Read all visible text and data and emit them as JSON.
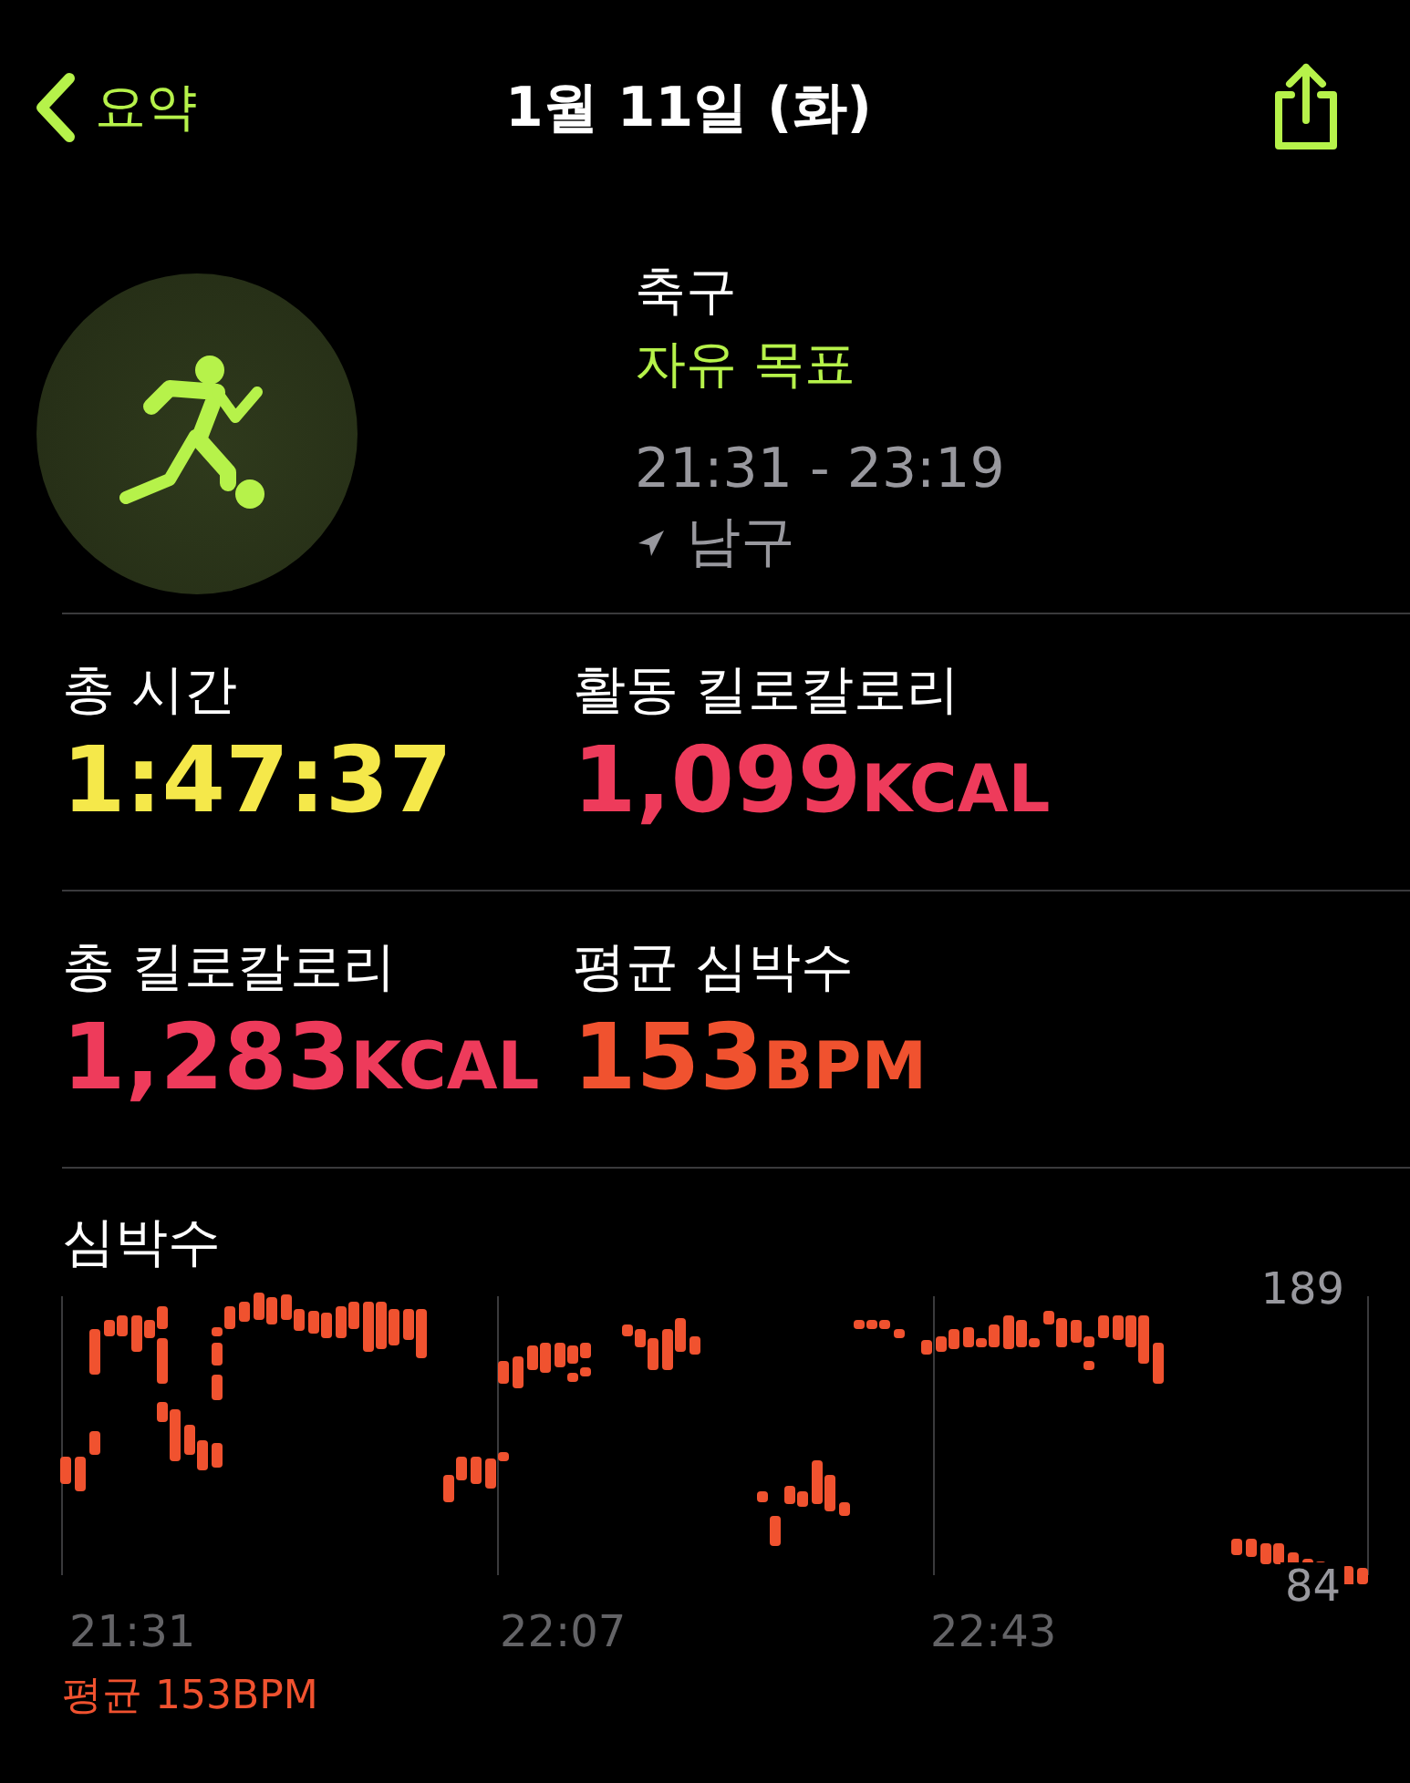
{
  "nav": {
    "back_label": "요약",
    "title": "1월 11일 (화)"
  },
  "workout": {
    "name": "축구",
    "goal": "자유 목표",
    "time_range": "21:31 - 23:19",
    "location": "남구"
  },
  "stats": [
    {
      "label": "총 시간",
      "value": "1:47:37",
      "kind": "time"
    },
    {
      "label": "활동 킬로칼로리",
      "value": "1,099",
      "unit": "KCAL",
      "kind": "energy"
    },
    {
      "label": "총 킬로칼로리",
      "value": "1,283",
      "unit": "KCAL",
      "kind": "energy"
    },
    {
      "label": "평균 심박수",
      "value": "153",
      "unit": "BPM",
      "kind": "heart"
    }
  ],
  "heart_rate": {
    "title": "심박수",
    "max_label": "189",
    "min_label": "84",
    "x_labels": [
      "21:31",
      "22:07",
      "22:43"
    ],
    "average": "평균 153BPM"
  }
}
